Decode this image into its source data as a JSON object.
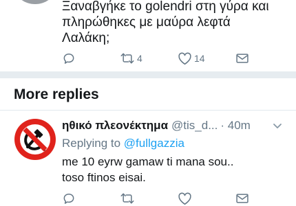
{
  "tweet_top": {
    "lines": [
      "Ξαναβγήκε το golendri στη γύρα και",
      "πληρώθηκες με μαύρα λεφτά",
      "Λαλάκη;"
    ],
    "retweet_count": "4",
    "like_count": "14"
  },
  "section": {
    "more_replies": "More replies"
  },
  "reply": {
    "display_name": "ηθικό πλεονέκτημα",
    "handle": "@tis_d...",
    "time": "· 40m",
    "replying_to_label": "Replying to",
    "replying_to_handle": "@fullgazzia",
    "lines": [
      "me 10 eyrw gamaw ti mana sou..",
      "toso ftinos eisai."
    ]
  },
  "colors": {
    "accent": "#1da1f2",
    "muted": "#657786",
    "text": "#14171a",
    "divider": "#e6ecf0",
    "avatar_red": "#e0231c"
  },
  "icons": [
    "reply-icon",
    "retweet-icon",
    "like-icon",
    "share-icon",
    "chevron-down-icon"
  ]
}
